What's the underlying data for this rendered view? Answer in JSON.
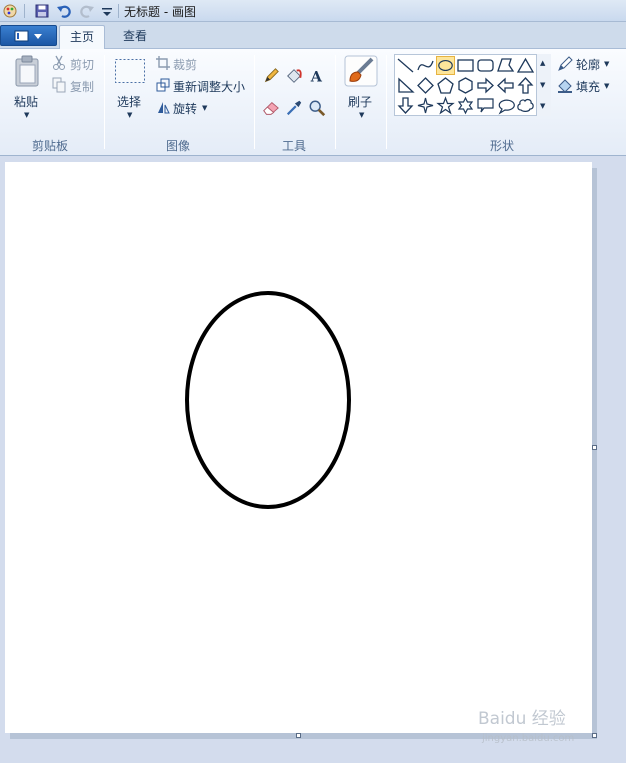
{
  "window": {
    "title": "无标题 - 画图"
  },
  "tabs": {
    "home": "主页",
    "view": "查看"
  },
  "clipboard": {
    "paste": "粘贴",
    "cut": "剪切",
    "copy": "复制",
    "group_label": "剪贴板"
  },
  "image": {
    "select": "选择",
    "crop": "裁剪",
    "resize": "重新调整大小",
    "rotate": "旋转",
    "group_label": "图像"
  },
  "tools": {
    "group_label": "工具",
    "icons": [
      "pencil-icon",
      "fill-bucket-icon",
      "text-icon",
      "eraser-icon",
      "color-picker-icon",
      "magnifier-icon"
    ]
  },
  "brushes": {
    "label": "刷子"
  },
  "shapes": {
    "group_label": "形状",
    "outline": "轮廓",
    "fill": "填充",
    "selected": "oval"
  },
  "canvas": {
    "stroke_color": "#000000",
    "background": "#ffffff"
  },
  "watermark": {
    "brand": "Baidu 经验",
    "url": "jingyan.baidu.com"
  },
  "colors": {
    "accent": "#1c57a5",
    "ribbon_bg": "#e4ecf7",
    "workspace": "#d3dced"
  }
}
